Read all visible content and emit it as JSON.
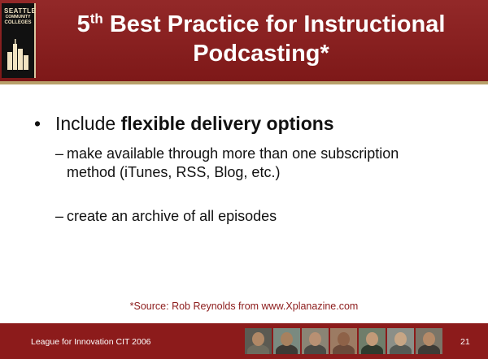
{
  "header": {
    "logo": {
      "line1": "SEATTLE",
      "line2": "COMMUNITY",
      "line3": "COLLEGES"
    },
    "title_ordinal": "5",
    "title_suffix": "th",
    "title_rest_line1": "Best Practice for Instructional",
    "title_line2": "Podcasting*"
  },
  "body": {
    "bullet": {
      "symbol": "•",
      "lead": "Include",
      "bold": "flexible delivery options"
    },
    "subbullets": [
      {
        "dash": "–",
        "text": "make available through more than one subscription method (iTunes, RSS, Blog, etc.)"
      },
      {
        "dash": "–",
        "text": "create an archive of all episodes"
      }
    ],
    "source": "*Source: Rob Reynolds from www.Xplanazine.com"
  },
  "footer": {
    "text": "League for Innovation CIT 2006",
    "page_number": "21",
    "photo_count": 7
  },
  "colors": {
    "header_bg": "#8c1b1b",
    "accent": "#b8a06a",
    "source_text": "#8c1b1b"
  }
}
